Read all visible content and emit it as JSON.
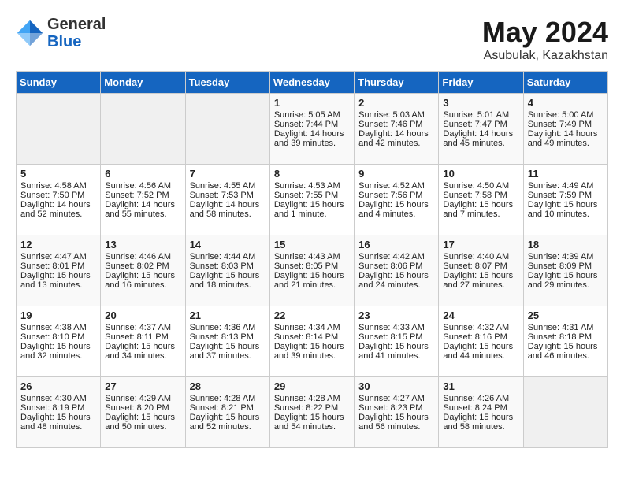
{
  "header": {
    "logo_general": "General",
    "logo_blue": "Blue",
    "title": "May 2024",
    "subtitle": "Asubulak, Kazakhstan"
  },
  "days_of_week": [
    "Sunday",
    "Monday",
    "Tuesday",
    "Wednesday",
    "Thursday",
    "Friday",
    "Saturday"
  ],
  "weeks": [
    [
      {
        "day": "",
        "empty": true
      },
      {
        "day": "",
        "empty": true
      },
      {
        "day": "",
        "empty": true
      },
      {
        "day": "1",
        "sunrise": "Sunrise: 5:05 AM",
        "sunset": "Sunset: 7:44 PM",
        "daylight": "Daylight: 14 hours and 39 minutes."
      },
      {
        "day": "2",
        "sunrise": "Sunrise: 5:03 AM",
        "sunset": "Sunset: 7:46 PM",
        "daylight": "Daylight: 14 hours and 42 minutes."
      },
      {
        "day": "3",
        "sunrise": "Sunrise: 5:01 AM",
        "sunset": "Sunset: 7:47 PM",
        "daylight": "Daylight: 14 hours and 45 minutes."
      },
      {
        "day": "4",
        "sunrise": "Sunrise: 5:00 AM",
        "sunset": "Sunset: 7:49 PM",
        "daylight": "Daylight: 14 hours and 49 minutes."
      }
    ],
    [
      {
        "day": "5",
        "sunrise": "Sunrise: 4:58 AM",
        "sunset": "Sunset: 7:50 PM",
        "daylight": "Daylight: 14 hours and 52 minutes."
      },
      {
        "day": "6",
        "sunrise": "Sunrise: 4:56 AM",
        "sunset": "Sunset: 7:52 PM",
        "daylight": "Daylight: 14 hours and 55 minutes."
      },
      {
        "day": "7",
        "sunrise": "Sunrise: 4:55 AM",
        "sunset": "Sunset: 7:53 PM",
        "daylight": "Daylight: 14 hours and 58 minutes."
      },
      {
        "day": "8",
        "sunrise": "Sunrise: 4:53 AM",
        "sunset": "Sunset: 7:55 PM",
        "daylight": "Daylight: 15 hours and 1 minute."
      },
      {
        "day": "9",
        "sunrise": "Sunrise: 4:52 AM",
        "sunset": "Sunset: 7:56 PM",
        "daylight": "Daylight: 15 hours and 4 minutes."
      },
      {
        "day": "10",
        "sunrise": "Sunrise: 4:50 AM",
        "sunset": "Sunset: 7:58 PM",
        "daylight": "Daylight: 15 hours and 7 minutes."
      },
      {
        "day": "11",
        "sunrise": "Sunrise: 4:49 AM",
        "sunset": "Sunset: 7:59 PM",
        "daylight": "Daylight: 15 hours and 10 minutes."
      }
    ],
    [
      {
        "day": "12",
        "sunrise": "Sunrise: 4:47 AM",
        "sunset": "Sunset: 8:01 PM",
        "daylight": "Daylight: 15 hours and 13 minutes."
      },
      {
        "day": "13",
        "sunrise": "Sunrise: 4:46 AM",
        "sunset": "Sunset: 8:02 PM",
        "daylight": "Daylight: 15 hours and 16 minutes."
      },
      {
        "day": "14",
        "sunrise": "Sunrise: 4:44 AM",
        "sunset": "Sunset: 8:03 PM",
        "daylight": "Daylight: 15 hours and 18 minutes."
      },
      {
        "day": "15",
        "sunrise": "Sunrise: 4:43 AM",
        "sunset": "Sunset: 8:05 PM",
        "daylight": "Daylight: 15 hours and 21 minutes."
      },
      {
        "day": "16",
        "sunrise": "Sunrise: 4:42 AM",
        "sunset": "Sunset: 8:06 PM",
        "daylight": "Daylight: 15 hours and 24 minutes."
      },
      {
        "day": "17",
        "sunrise": "Sunrise: 4:40 AM",
        "sunset": "Sunset: 8:07 PM",
        "daylight": "Daylight: 15 hours and 27 minutes."
      },
      {
        "day": "18",
        "sunrise": "Sunrise: 4:39 AM",
        "sunset": "Sunset: 8:09 PM",
        "daylight": "Daylight: 15 hours and 29 minutes."
      }
    ],
    [
      {
        "day": "19",
        "sunrise": "Sunrise: 4:38 AM",
        "sunset": "Sunset: 8:10 PM",
        "daylight": "Daylight: 15 hours and 32 minutes."
      },
      {
        "day": "20",
        "sunrise": "Sunrise: 4:37 AM",
        "sunset": "Sunset: 8:11 PM",
        "daylight": "Daylight: 15 hours and 34 minutes."
      },
      {
        "day": "21",
        "sunrise": "Sunrise: 4:36 AM",
        "sunset": "Sunset: 8:13 PM",
        "daylight": "Daylight: 15 hours and 37 minutes."
      },
      {
        "day": "22",
        "sunrise": "Sunrise: 4:34 AM",
        "sunset": "Sunset: 8:14 PM",
        "daylight": "Daylight: 15 hours and 39 minutes."
      },
      {
        "day": "23",
        "sunrise": "Sunrise: 4:33 AM",
        "sunset": "Sunset: 8:15 PM",
        "daylight": "Daylight: 15 hours and 41 minutes."
      },
      {
        "day": "24",
        "sunrise": "Sunrise: 4:32 AM",
        "sunset": "Sunset: 8:16 PM",
        "daylight": "Daylight: 15 hours and 44 minutes."
      },
      {
        "day": "25",
        "sunrise": "Sunrise: 4:31 AM",
        "sunset": "Sunset: 8:18 PM",
        "daylight": "Daylight: 15 hours and 46 minutes."
      }
    ],
    [
      {
        "day": "26",
        "sunrise": "Sunrise: 4:30 AM",
        "sunset": "Sunset: 8:19 PM",
        "daylight": "Daylight: 15 hours and 48 minutes."
      },
      {
        "day": "27",
        "sunrise": "Sunrise: 4:29 AM",
        "sunset": "Sunset: 8:20 PM",
        "daylight": "Daylight: 15 hours and 50 minutes."
      },
      {
        "day": "28",
        "sunrise": "Sunrise: 4:28 AM",
        "sunset": "Sunset: 8:21 PM",
        "daylight": "Daylight: 15 hours and 52 minutes."
      },
      {
        "day": "29",
        "sunrise": "Sunrise: 4:28 AM",
        "sunset": "Sunset: 8:22 PM",
        "daylight": "Daylight: 15 hours and 54 minutes."
      },
      {
        "day": "30",
        "sunrise": "Sunrise: 4:27 AM",
        "sunset": "Sunset: 8:23 PM",
        "daylight": "Daylight: 15 hours and 56 minutes."
      },
      {
        "day": "31",
        "sunrise": "Sunrise: 4:26 AM",
        "sunset": "Sunset: 8:24 PM",
        "daylight": "Daylight: 15 hours and 58 minutes."
      },
      {
        "day": "",
        "empty": true
      }
    ]
  ]
}
